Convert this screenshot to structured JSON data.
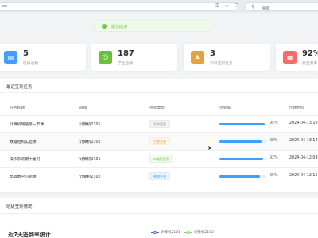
{
  "browser": {
    "url_text": "ew",
    "search_label": "搜索"
  },
  "toast": {
    "message": "提交成功"
  },
  "stats": [
    {
      "value": "5",
      "label": "班级总数",
      "icon": "school-icon",
      "color": "#409eff"
    },
    {
      "value": "187",
      "label": "学生总数",
      "icon": "user-group-icon",
      "color": "#67c23a"
    },
    {
      "value": "3",
      "label": "今日签到任务",
      "icon": "person-icon",
      "color": "#e6a23c"
    },
    {
      "value": "92%",
      "label": "总签到率",
      "icon": "chart-icon",
      "color": "#f56c6c"
    }
  ],
  "recent_tasks": {
    "title": "最近签到任务",
    "columns": [
      "任务标题",
      "班级",
      "签到类型",
      "签到率",
      "创建时间"
    ],
    "rows": [
      {
        "title": "计算机网络第一节课",
        "class": "计算机2101",
        "type": "手势签到",
        "type_color": "#909399",
        "rate": 95,
        "rate_text": "95%",
        "time": "2024-04-13 10"
      },
      {
        "title": "数据结构实验课",
        "class": "计算机2102",
        "type": "位置签到",
        "type_color": "#e6a23c",
        "rate": 88,
        "rate_text": "88%",
        "time": "2024-04-13 14"
      },
      {
        "title": "操作系统期中复习",
        "class": "计算机2101",
        "type": "二维码签到",
        "type_color": "#67c23a",
        "rate": 92,
        "rate_text": "92%",
        "time": "2024-04-12 09"
      },
      {
        "title": "高等数学习题课",
        "class": "计算机2102",
        "type": "普通签到",
        "type_color": "#409eff",
        "rate": 85,
        "rate_text": "85%",
        "time": "2024-04-12 15"
      }
    ]
  },
  "class_stats": {
    "title": "班级签到情况",
    "chart_title": "近7天签到率统计",
    "legend": [
      {
        "name": "计算机2101",
        "color": "#5470c6"
      },
      {
        "name": "计算机2102",
        "color": "#91cc75"
      }
    ]
  }
}
